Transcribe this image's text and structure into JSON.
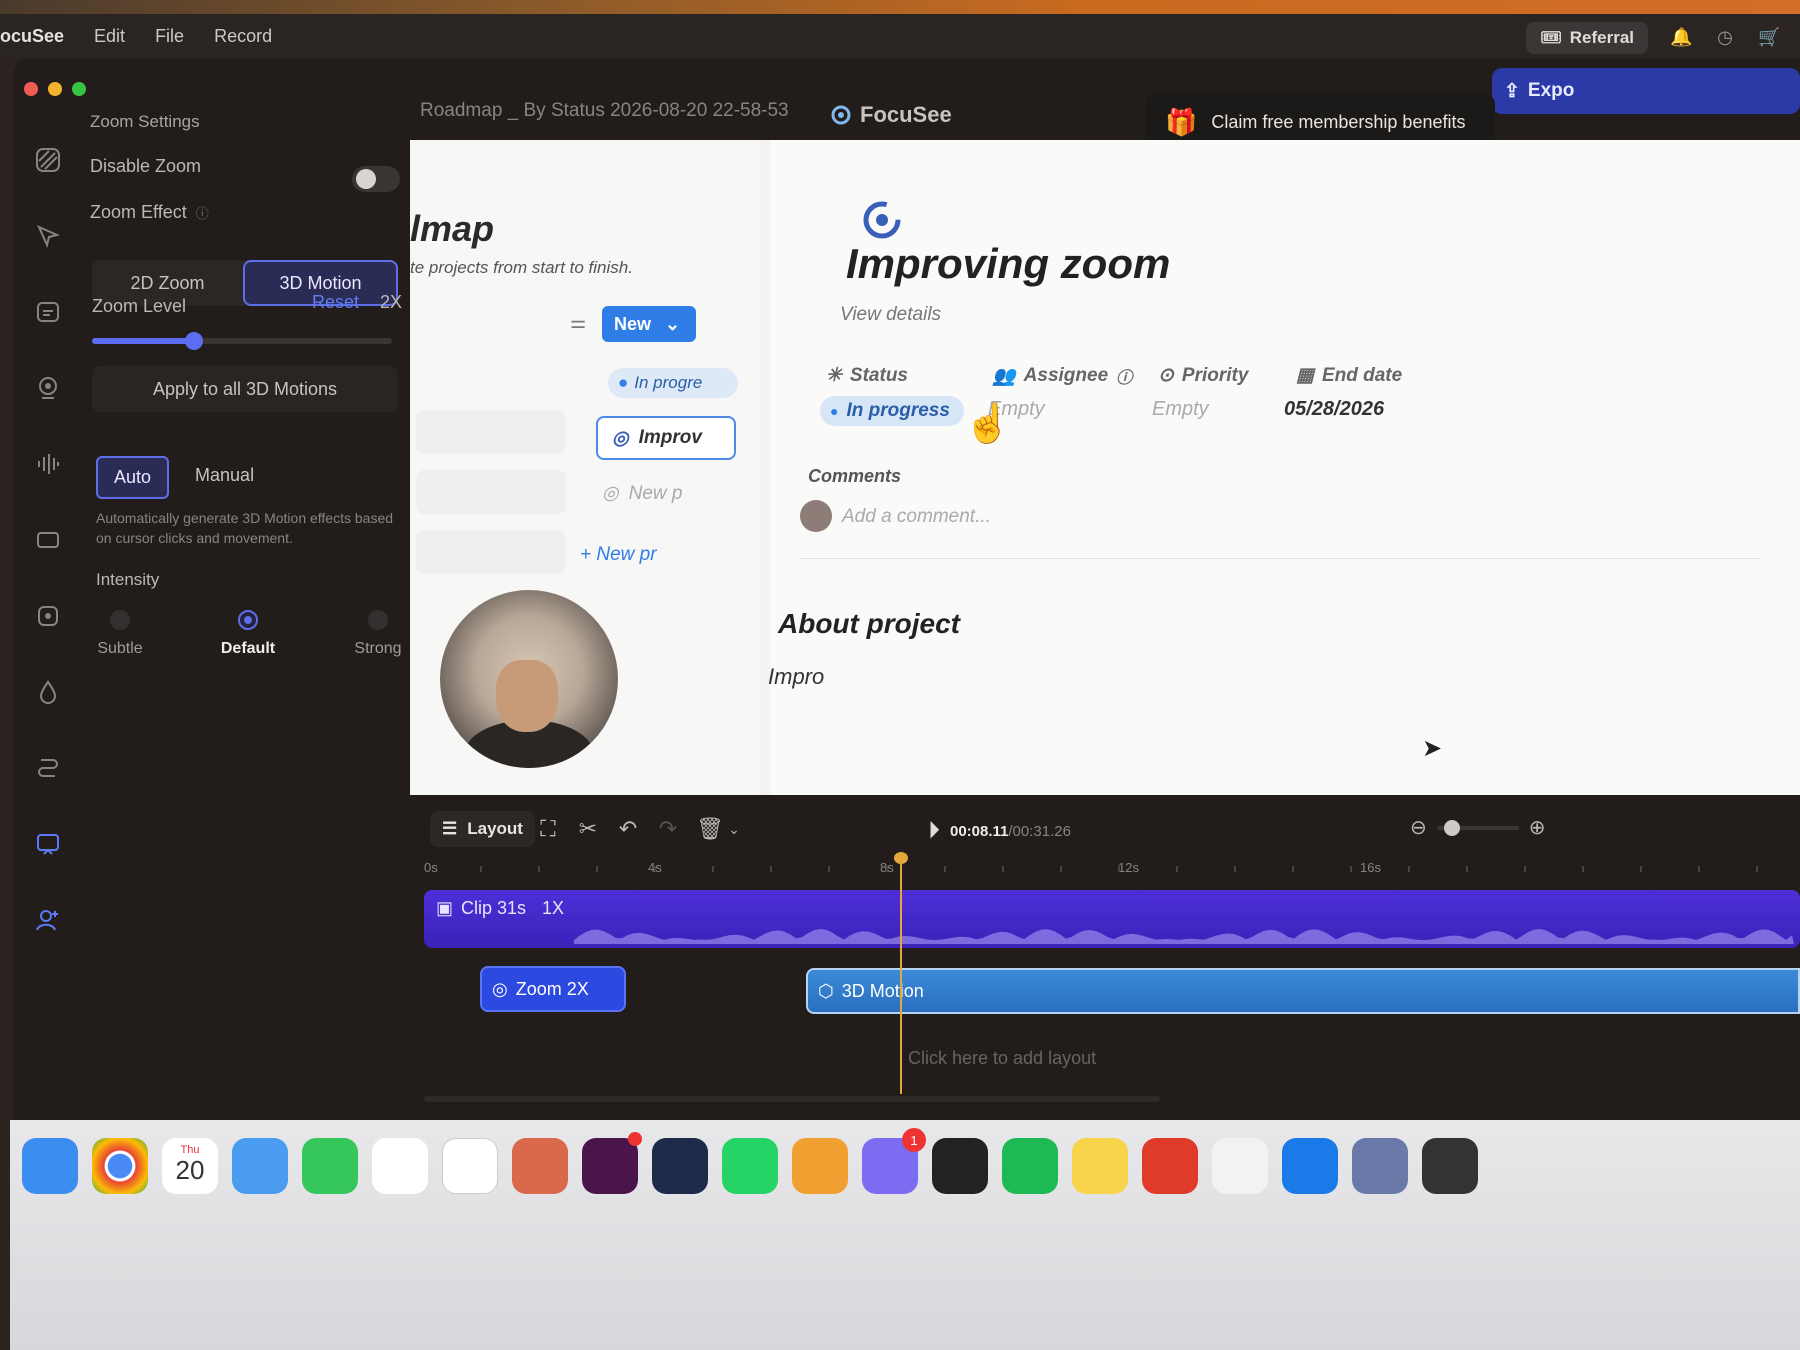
{
  "menubar": {
    "app_name": "ocuSee",
    "items": [
      "Edit",
      "File",
      "Record"
    ],
    "referral_label": "Referral"
  },
  "window": {
    "app_title": "FocuSee",
    "recording_title": "Roadmap _ By Status 2026-08-20 22-58-53",
    "claim_banner": "Claim free membership benefits",
    "export_label": "Expo"
  },
  "settings": {
    "section_title": "Zoom Settings",
    "disable_zoom_label": "Disable Zoom",
    "disable_zoom_on": false,
    "zoom_effect_label": "Zoom Effect",
    "effect_options": [
      "2D Zoom",
      "3D Motion"
    ],
    "effect_selected": "3D Motion",
    "zoom_level_label": "Zoom Level",
    "reset_label": "Reset",
    "zoom_level_value": "2X",
    "zoom_level_fraction": 0.34,
    "apply_all_label": "Apply to all 3D Motions",
    "mode_options": [
      "Auto",
      "Manual"
    ],
    "mode_selected": "Auto",
    "auto_description": "Automatically generate 3D Motion effects based on cursor clicks and movement.",
    "intensity_label": "Intensity",
    "intensity_options": [
      "Subtle",
      "Default",
      "Strong"
    ],
    "intensity_selected": "Default"
  },
  "preview": {
    "left_page": {
      "heading": "lmap",
      "subtitle": "te projects from start to finish.",
      "new_button": "New",
      "badge": "In progre",
      "card_improv": "Improv",
      "card_new": "New p",
      "add_new": "+ New pr"
    },
    "detail": {
      "title": "Improving zoom",
      "view_details": "View details",
      "props": {
        "status_h": "Status",
        "assignee_h": "Assignee",
        "priority_h": "Priority",
        "end_date_h": "End date",
        "status_v": "In progress",
        "assignee_v": "Empty",
        "priority_v": "Empty",
        "end_date_v": "05/28/2026"
      },
      "comments_h": "Comments",
      "comment_placeholder": "Add a comment...",
      "about_h": "About project",
      "about_text": "Impro"
    }
  },
  "toolbar": {
    "layout_label": "Layout",
    "time_current": "00:08.11",
    "time_total": "/00:31.26",
    "zoom_fraction": 0.18
  },
  "timeline": {
    "ruler": [
      "0s",
      "4s",
      "8s",
      "12s",
      "16s"
    ],
    "clip_label": "Clip 31s",
    "clip_speed": "1X",
    "zoom_clip": "Zoom 2X",
    "motion_clip": "3D Motion",
    "add_layout": "Click here to add layout"
  },
  "dock": {
    "calendar_day": "Thu",
    "calendar_date": "20",
    "badges": {
      "slack": "",
      "messenger": "1"
    }
  },
  "colors": {
    "accent": "#5b6df0",
    "clip": "#4d2fd8",
    "motion": "#3a8bd8",
    "playhead": "#e3a83a"
  }
}
